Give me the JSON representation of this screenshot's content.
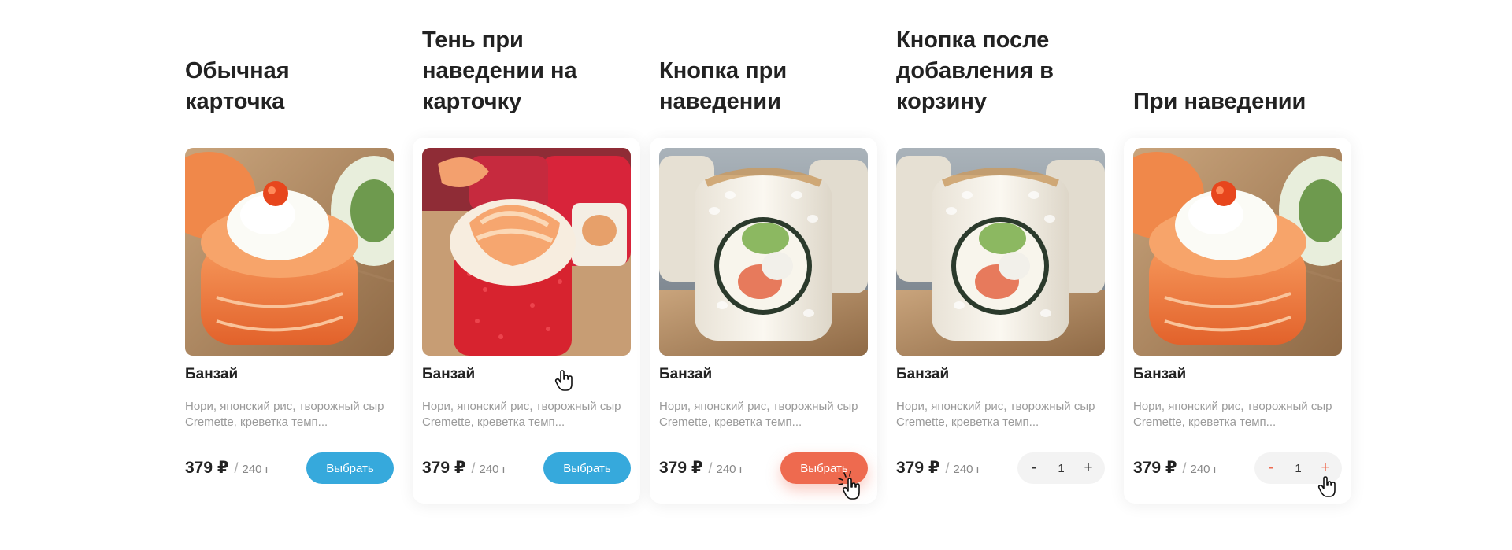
{
  "columns": [
    {
      "heading": "Обычная карточка"
    },
    {
      "heading": "Тень при наведении на карточку"
    },
    {
      "heading": "Кнопка при наведении"
    },
    {
      "heading": "Кнопка после добавления в корзину"
    },
    {
      "heading": "При наведении"
    }
  ],
  "product": {
    "title": "Банзай",
    "description": "Нори, японский рис, творожный сыр Cremette, креветка темп...",
    "price": "379 ₽",
    "separator": "/",
    "weight": "240 г",
    "select_label": "Выбрать",
    "quantity": "1",
    "minus": "-",
    "plus": "+"
  },
  "colors": {
    "blue": "#36a9dc",
    "orange": "#ee6a4f"
  },
  "icons": [
    "salmon-roll-image",
    "shrimp-roll-image",
    "philadelphia-roll-image",
    "hand-pointer-icon"
  ]
}
